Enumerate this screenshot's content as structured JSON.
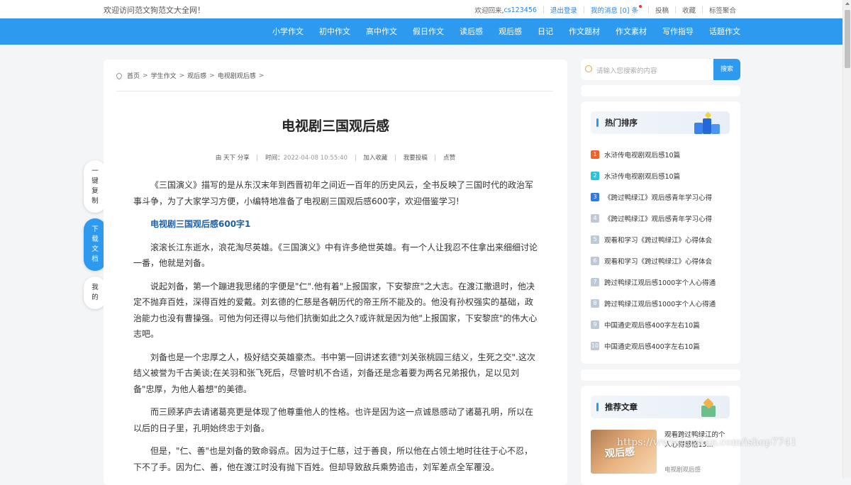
{
  "topbar": {
    "welcome": "欢迎访问范文狗范文大全网！",
    "greeting": "欢迎回来,",
    "username": "cs123456",
    "logout": "退出登录",
    "messages_prefix": "我的消息 [",
    "messages_count": "0",
    "messages_suffix": "] 条",
    "submit": "投稿",
    "favorite": "收藏",
    "tag_aggregate": "标签聚合"
  },
  "nav": {
    "items": [
      "小学作文",
      "初中作文",
      "高中作文",
      "假日作文",
      "读后感",
      "观后感",
      "日记",
      "作文题材",
      "作文素材",
      "写作指导",
      "话题作文"
    ]
  },
  "breadcrumb": {
    "home": "首页",
    "level1": "学生作文",
    "level2": "观后感",
    "level3": "电视剧观后感",
    "sep": ">"
  },
  "article": {
    "title": "电视剧三国观后感",
    "author": "由 天下 分享",
    "time_label": "时间：",
    "time_value": "2022-04-08 10:55:40",
    "add_fav": "加入收藏",
    "submit": "我要投稿",
    "like": "点赞",
    "intro": "《三国演义》描写的是从东汉末年到西晋初年之间近一百年的历史风云，全书反映了三国时代的政治军事斗争，为了大家学习方便，小编特地准备了电视剧三国观后感600字，欢迎借鉴学习!",
    "subtitle": "电视剧三国观后感600字1",
    "paragraphs": [
      "滚滚长江东逝水，浪花淘尽英雄。《三国演义》中有许多绝世英雄。有一个人让我忍不住拿出来细细讨论一番，他就是刘备。",
      "说起刘备，第一个蹦进我思绪的字便是\"仁\".他有着\"上报国家，下安黎庶\"之大志。在渡江撤退时，他决定不抛弃百姓，深得百姓的爱戴。刘玄德的仁慈是各朝历代的帝王所不能及的。他没有孙权强实的基础，政治能力也没有曹操强。可他为何还得以与他们抗衡如此之久?或许就是因为他\"上报国家，下安黎庶\"的伟大心志吧。",
      "刘备也是一个忠厚之人，极好结交英雄豪杰。书中第一回讲述玄德\"刘关张桃园三结义，生死之交\".这次结义被誉为千古美谈;在关羽和张飞死后，尽管时机不合适，刘备还是念着要为两名兄弟报仇，足以见刘备\"忠厚，为他人着想\"的美德。",
      "而三顾茅庐去请诸葛亮更是体现了他尊重他人的性格。也许是因为这一点诚恳感动了诸葛孔明，所以在以后的日子里，孔明始终忠于刘备。",
      "但是，\"仁、善\"也是刘备的致命弱点。因为过于仁慈，过于善良，所以他在占领土地时往往于心不忍，下不了手。因为仁、善，他在渡江时没有抛下百姓。但却导致敌兵乘势追击，刘军差点全军覆没。"
    ]
  },
  "side_buttons": {
    "copy": [
      "一",
      "键",
      "复",
      "制"
    ],
    "download": [
      "下",
      "载",
      "文",
      "档"
    ],
    "mine": [
      "我",
      "的"
    ]
  },
  "search": {
    "placeholder": "请输入您搜索的内容",
    "button": "搜索"
  },
  "hot": {
    "title": "热门排序",
    "items": [
      {
        "n": "1",
        "text": "水浒传电视剧观后感10篇",
        "color": "#f0622d"
      },
      {
        "n": "2",
        "text": "水浒传电视剧观后感10篇",
        "color": "#29c4d8"
      },
      {
        "n": "3",
        "text": "《跨过鸭绿江》观后感青年学习心得",
        "color": "#2d7ae8"
      },
      {
        "n": "4",
        "text": "《跨过鸭绿江》观后感青年学习心得",
        "color": "#bfc8d6"
      },
      {
        "n": "5",
        "text": "观看和学习《跨过鸭绿江》心得体会",
        "color": "#bfc8d6"
      },
      {
        "n": "6",
        "text": "观看和学习《跨过鸭绿江》心得体会",
        "color": "#bfc8d6"
      },
      {
        "n": "7",
        "text": "跨过鸭绿江观后感1000字个人心得通",
        "color": "#bfc8d6"
      },
      {
        "n": "8",
        "text": "跨过鸭绿江观后感1000字个人心得通",
        "color": "#bfc8d6"
      },
      {
        "n": "9",
        "text": "中国通史观后感400字左右10篇",
        "color": "#bfc8d6"
      },
      {
        "n": "10",
        "text": "中国通史观后感400字左右10篇",
        "color": "#bfc8d6"
      }
    ]
  },
  "recommend": {
    "title": "推荐文章",
    "thumb_label": "观后感",
    "item_title": "观看跨过鸭绿江的个人心得感悟15...",
    "item_category": "电视剧观后感"
  },
  "watermark": "https://www.huzhan.com/ishop7741",
  "colors": {
    "primary": "#2d9af0",
    "link": "#2b84e6",
    "subtitle": "#1e5fa8"
  }
}
